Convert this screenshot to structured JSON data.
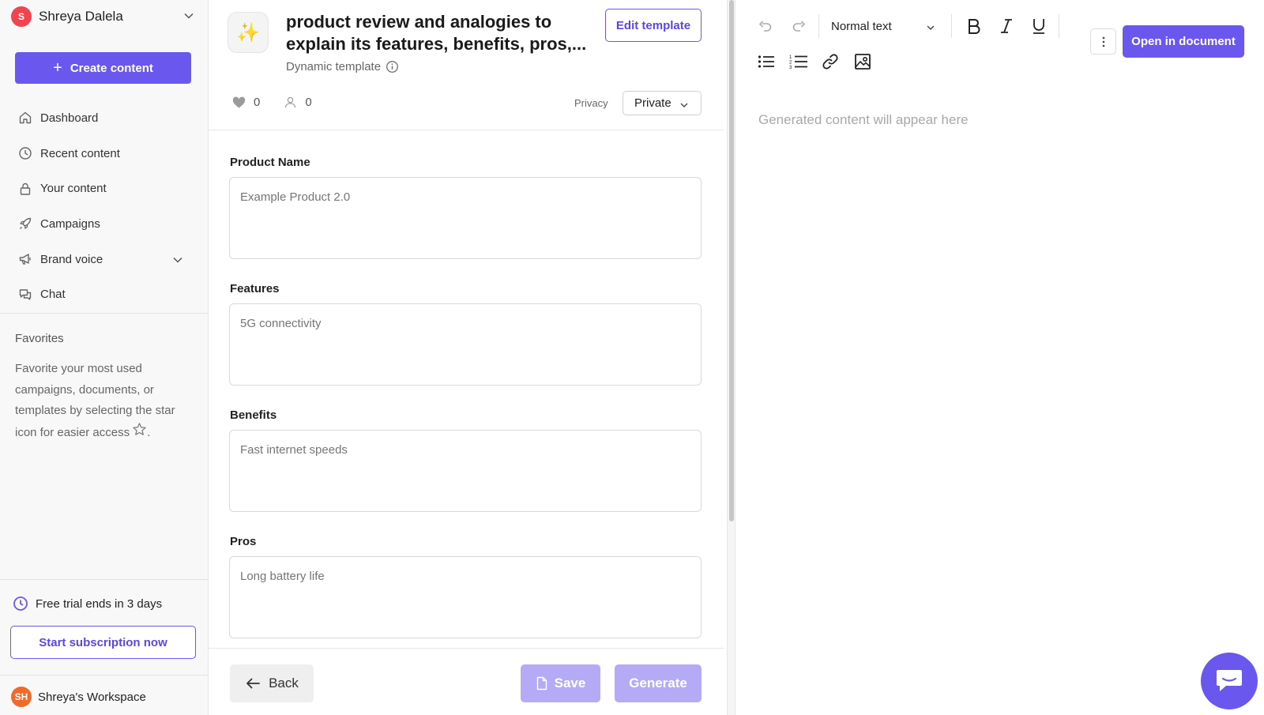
{
  "user": {
    "initial": "S",
    "name": "Shreya Dalela"
  },
  "sidebar": {
    "create_label": "Create content",
    "items": [
      {
        "label": "Dashboard",
        "icon": "home-icon"
      },
      {
        "label": "Recent content",
        "icon": "clock-icon"
      },
      {
        "label": "Your content",
        "icon": "lock-icon"
      },
      {
        "label": "Campaigns",
        "icon": "rocket-icon"
      },
      {
        "label": "Brand voice",
        "icon": "megaphone-icon"
      },
      {
        "label": "Chat",
        "icon": "chat-icon"
      }
    ],
    "favorites_title": "Favorites",
    "favorites_text": "Favorite your most used campaigns, documents, or templates by selecting the star icon for easier access",
    "favorites_suffix": "."
  },
  "trial": {
    "text": "Free trial ends in 3 days",
    "subscribe_label": "Start subscription now"
  },
  "workspace": {
    "initials": "SH",
    "name": "Shreya's Workspace"
  },
  "template": {
    "title": "product review and analogies to\nexplain its features, benefits, pros,...",
    "subtitle": "Dynamic template",
    "edit_label": "Edit template",
    "likes": "0",
    "users": "0",
    "privacy_label": "Privacy",
    "privacy_value": "Private"
  },
  "form": {
    "fields": [
      {
        "label": "Product Name",
        "placeholder": "Example Product 2.0"
      },
      {
        "label": "Features",
        "placeholder": "5G connectivity"
      },
      {
        "label": "Benefits",
        "placeholder": "Fast internet speeds"
      },
      {
        "label": "Pros",
        "placeholder": "Long battery life"
      }
    ]
  },
  "actions": {
    "back": "Back",
    "save": "Save",
    "generate": "Generate"
  },
  "editor": {
    "text_style": "Normal text",
    "open_label": "Open in document",
    "placeholder": "Generated content will appear here"
  },
  "colors": {
    "accent": "#6a57ee",
    "accent_disabled": "#b4aaf5",
    "avatar_user": "#f0444f",
    "avatar_workspace": "#f06a2a"
  }
}
